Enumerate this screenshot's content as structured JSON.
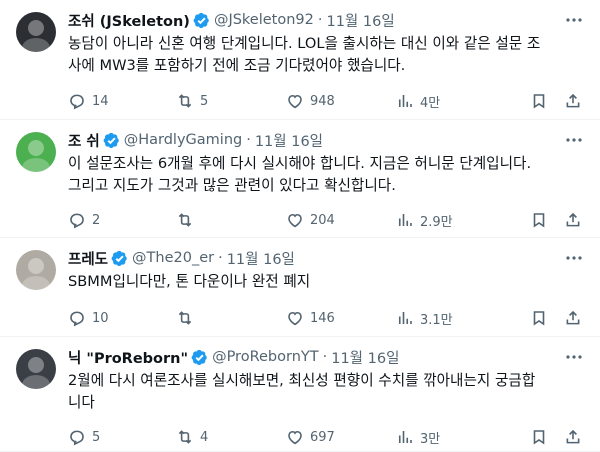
{
  "tweets": [
    {
      "name": "조쉬 (JSkeleton)",
      "handle": "@JSkeleton92",
      "dot": "·",
      "date": "11월 16일",
      "lines": [
        "농담이 아니라 신혼 여행 단계입니다. LOL을 출시하는 대신 이와 같은 설문 조",
        "사에 MW3를 포함하기 전에 조금 기다렸어야 했습니다."
      ],
      "replies": "14",
      "retweets": "5",
      "likes": "948",
      "views": "4만",
      "avatar_color": "#2b2f33"
    },
    {
      "name": "조 쉬",
      "handle": "@HardlyGaming",
      "dot": "·",
      "date": "11월 16일",
      "lines": [
        "이 설문조사는 6개월 후에 다시 실시해야 합니다. 지금은 허니문 단계입니다.",
        "그리고 지도가 그것과 많은 관련이 있다고 확신합니다."
      ],
      "replies": "2",
      "retweets": "",
      "likes": "204",
      "views": "2.9만",
      "avatar_color": "#4caf50"
    },
    {
      "name": "프레도",
      "handle": "@The20_er",
      "dot": "·",
      "date": "11월 16일",
      "lines": [
        "SBMM입니다만, 톤 다운이나 완전 폐지"
      ],
      "replies": "10",
      "retweets": "",
      "likes": "146",
      "views": "3.1만",
      "avatar_color": "#b0aba2"
    },
    {
      "name": "닉 \"ProReborn\"",
      "handle": "@ProRebornYT",
      "dot": "·",
      "date": "11월 16일",
      "lines": [
        "2월에 다시 여론조사를 실시해보면, 최신성 편향이 수치를 깎아내는지 궁금합",
        "니다"
      ],
      "replies": "5",
      "retweets": "4",
      "likes": "697",
      "views": "3만",
      "avatar_color": "#3a3f45"
    }
  ],
  "colors": {
    "verified": "#1d9bf0",
    "secondary_text": "#536471",
    "divider": "#eff3f4"
  },
  "icons": [
    "more-icon",
    "verified-badge-icon",
    "reply-icon",
    "retweet-icon",
    "like-icon",
    "views-icon",
    "bookmark-icon",
    "share-icon"
  ]
}
